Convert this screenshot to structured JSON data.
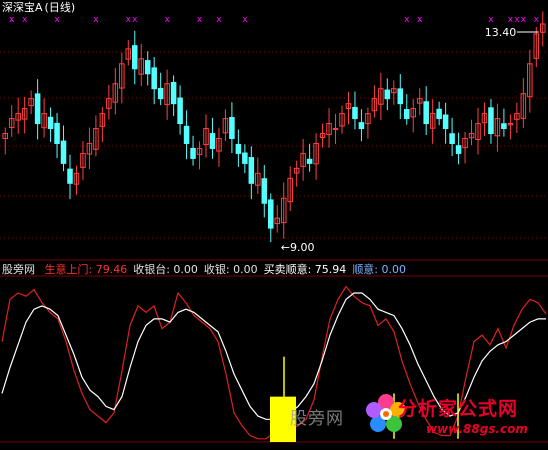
{
  "header_top": {
    "title": "深深宝A",
    "period": "(日线)"
  },
  "indicator_header": {
    "name": "股旁网",
    "items": [
      {
        "label": "生意上门:",
        "value": "79.46",
        "color": "#ff3030"
      },
      {
        "label": "收银台:",
        "value": "0.00",
        "color": "#e0e0e0"
      },
      {
        "label": "收银:",
        "value": "0.00",
        "color": "#e0e0e0"
      },
      {
        "label": "买卖顺意:",
        "value": "75.94",
        "color": "#ffffff"
      },
      {
        "label": "顺意:",
        "value": "0.00",
        "color": "#7fb3ff"
      }
    ]
  },
  "watermark": {
    "text": "股旁网",
    "logo_main": "分析家公式网",
    "logo_sub": "www.88gs.com"
  },
  "colors": {
    "up": "#ff4040",
    "down": "#54ffff",
    "grid": "#7a0000",
    "red_line": "#e02020",
    "white_line": "#ffffff",
    "signal": "#ffff00",
    "marker": "#ff00ff"
  },
  "chart_data": [
    {
      "type": "candlestick",
      "title": "深深宝A (日线)",
      "annotations": [
        {
          "text": "13.40",
          "value": 13.4,
          "kind": "high"
        },
        {
          "text": "9.00",
          "value": 9.0,
          "kind": "low"
        }
      ],
      "ylim": [
        8.7,
        13.6
      ],
      "markers": "x",
      "closes": [
        11.2,
        11.5,
        11.6,
        11.7,
        11.9,
        11.4,
        11.6,
        11.3,
        11.0,
        10.6,
        10.2,
        10.4,
        10.8,
        11.0,
        11.3,
        11.6,
        11.9,
        12.2,
        12.6,
        12.9,
        12.5,
        12.7,
        12.4,
        12.1,
        11.9,
        12.2,
        11.8,
        11.4,
        11.0,
        10.7,
        10.9,
        11.3,
        10.9,
        11.1,
        11.5,
        11.1,
        10.8,
        10.6,
        10.2,
        10.4,
        9.8,
        9.3,
        9.5,
        9.9,
        10.3,
        10.5,
        10.8,
        10.6,
        11.0,
        11.2,
        11.4,
        11.3,
        11.6,
        11.8,
        11.5,
        11.3,
        11.6,
        11.9,
        12.1,
        11.9,
        12.1,
        11.8,
        11.5,
        11.7,
        11.9,
        11.4,
        11.6,
        11.5,
        11.3,
        11.0,
        10.8,
        11.1,
        11.2,
        11.4,
        11.6,
        11.2,
        11.5,
        11.3,
        11.4,
        11.6,
        12.0,
        12.6,
        13.2,
        13.4
      ],
      "markers_x": [
        1,
        3,
        8,
        14,
        19,
        20,
        25,
        30,
        33,
        37,
        62,
        64,
        75,
        78,
        79,
        80,
        82
      ]
    },
    {
      "type": "line",
      "series": [
        {
          "name": "生意上门",
          "color": "#e02020",
          "values": [
            62,
            88,
            92,
            90,
            94,
            86,
            80,
            76,
            62,
            44,
            30,
            20,
            16,
            12,
            18,
            44,
            72,
            84,
            80,
            84,
            70,
            74,
            92,
            86,
            78,
            74,
            70,
            62,
            42,
            18,
            10,
            4,
            2,
            2,
            6,
            10,
            8,
            10,
            14,
            26,
            52,
            76,
            88,
            96,
            90,
            86,
            84,
            72,
            76,
            68,
            50,
            36,
            24,
            14,
            6,
            4,
            4,
            16,
            40,
            62,
            66,
            60,
            70,
            58,
            72,
            82,
            88,
            86,
            79
          ]
        },
        {
          "name": "买卖顺意",
          "color": "#ffffff",
          "values": [
            30,
            46,
            60,
            74,
            82,
            84,
            82,
            78,
            66,
            54,
            40,
            32,
            28,
            22,
            20,
            28,
            46,
            62,
            72,
            76,
            76,
            74,
            80,
            82,
            80,
            76,
            72,
            68,
            56,
            42,
            32,
            22,
            16,
            14,
            14,
            16,
            18,
            22,
            28,
            36,
            50,
            66,
            78,
            88,
            92,
            92,
            88,
            82,
            80,
            78,
            70,
            60,
            48,
            38,
            28,
            20,
            16,
            18,
            28,
            40,
            50,
            56,
            60,
            62,
            66,
            70,
            74,
            76,
            76
          ]
        }
      ],
      "ylim": [
        0,
        100
      ],
      "signals": [
        {
          "name": "收银台",
          "value": 28,
          "at": 34
        }
      ]
    }
  ]
}
